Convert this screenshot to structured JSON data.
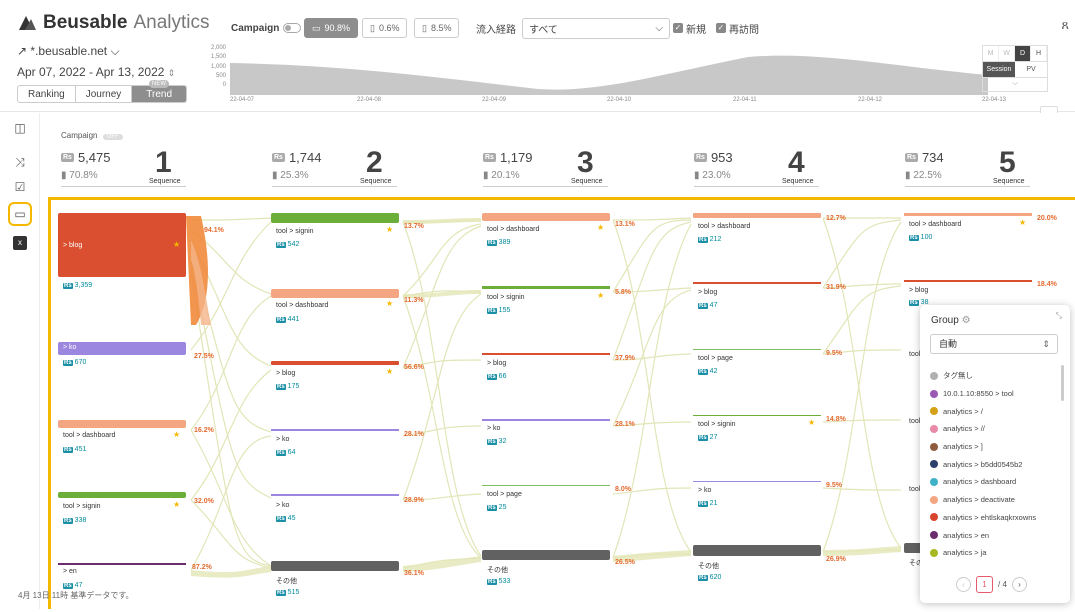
{
  "header": {
    "logo_brand": "Beusable",
    "logo_product": "Analytics",
    "site": "*.beusable.net",
    "date_range": "Apr 07, 2022 - Apr 13, 2022",
    "tabs": [
      "Ranking",
      "Journey",
      "Trend"
    ],
    "new_badge": "NEW",
    "campaign_label": "Campaign",
    "devices": [
      {
        "icon": "desktop-icon",
        "value": "90.8%",
        "active": true
      },
      {
        "icon": "tablet-icon",
        "value": "0.6%",
        "active": false
      },
      {
        "icon": "mobile-icon",
        "value": "8.5%",
        "active": false
      }
    ],
    "inflow_label": "流入経路",
    "inflow_value": "すべて",
    "check_new": "新規",
    "check_return": "再訪問"
  },
  "mini_chart": {
    "y_ticks": [
      "2,000",
      "1,500",
      "1,000",
      "500",
      "0"
    ],
    "x_ticks": [
      "22-04-07",
      "22-04-08",
      "22-04-09",
      "22-04-10",
      "22-04-11",
      "22-04-12",
      "22-04-13"
    ],
    "granularity": [
      "M",
      "W",
      "D",
      "H"
    ],
    "metric": [
      "Session",
      "PV"
    ]
  },
  "campaign_status": {
    "label": "Campaign",
    "state": "OFF"
  },
  "sequences": [
    {
      "count": "5,475",
      "pct": "70.8%",
      "num": "1",
      "label": "Sequence"
    },
    {
      "count": "1,744",
      "pct": "25.3%",
      "num": "2",
      "label": "Sequence"
    },
    {
      "count": "1,179",
      "pct": "20.1%",
      "num": "3",
      "label": "Sequence"
    },
    {
      "count": "953",
      "pct": "23.0%",
      "num": "4",
      "label": "Sequence"
    },
    {
      "count": "734",
      "pct": "22.5%",
      "num": "5",
      "label": "Sequence"
    }
  ],
  "rs_badge": "Rs",
  "nodes": [
    {
      "name": "> blog",
      "count": "3,359",
      "pct": "94.1%"
    },
    {
      "name": "> ko",
      "count": "670",
      "pct": "27.5%"
    },
    {
      "name": "tool > dashboard",
      "count": "451",
      "pct": "16.2%"
    },
    {
      "name": "tool > signin",
      "count": "338",
      "pct": "32.0%"
    },
    {
      "name": "> en",
      "count": "47",
      "pct": "87.2%"
    },
    {
      "name": "tool > signin",
      "count": "542",
      "pct": "13.7%"
    },
    {
      "name": "tool > dashboard",
      "count": "441",
      "pct": "11.3%"
    },
    {
      "name": "> blog",
      "count": "175",
      "pct": "56.6%"
    },
    {
      "name": "> ko",
      "count": "64",
      "pct": "28.1%"
    },
    {
      "name": "> ko",
      "count": "45",
      "pct": "28.9%"
    },
    {
      "name": "その他",
      "count": "515",
      "pct": "36.1%"
    },
    {
      "name": "tool > dashboard",
      "count": "389",
      "pct": "13.1%"
    },
    {
      "name": "tool > signin",
      "count": "155",
      "pct": "5.8%"
    },
    {
      "name": "> blog",
      "count": "66",
      "pct": "37.9%"
    },
    {
      "name": "> ko",
      "count": "32",
      "pct": "28.1%"
    },
    {
      "name": "tool > page",
      "count": "25",
      "pct": "8.0%"
    },
    {
      "name": "その他",
      "count": "533",
      "pct": "26.5%"
    },
    {
      "name": "tool > dashboard",
      "count": "212",
      "pct": "12.7%"
    },
    {
      "name": "> blog",
      "count": "47",
      "pct": "31.9%"
    },
    {
      "name": "tool > page",
      "count": "42",
      "pct": "9.5%"
    },
    {
      "name": "tool > signin",
      "count": "27",
      "pct": "14.8%"
    },
    {
      "name": "> ko",
      "count": "21",
      "pct": "9.5%"
    },
    {
      "name": "その他",
      "count": "620",
      "pct": "26.9%"
    },
    {
      "name": "tool > dashboard",
      "count": "100",
      "pct": "20.0%"
    },
    {
      "name": "> blog",
      "count": "38",
      "pct": "18.4%"
    },
    {
      "name": "tool",
      "count": "",
      "pct": ""
    },
    {
      "name": "tool",
      "count": "",
      "pct": ""
    },
    {
      "name": "tool",
      "count": "",
      "pct": ""
    },
    {
      "name": "その",
      "count": "",
      "pct": ""
    }
  ],
  "group_panel": {
    "title": "Group",
    "select_value": "自動",
    "items": [
      {
        "label": "タグ無し",
        "color": "#b0b0b0"
      },
      {
        "label": "10.0.1.10:8550 > tool",
        "color": "#9b59b6"
      },
      {
        "label": "analytics > /",
        "color": "#d4a017"
      },
      {
        "label": "analytics > //",
        "color": "#e88aa8"
      },
      {
        "label": "analytics > ]",
        "color": "#8e5b3f"
      },
      {
        "label": "analytics > b5dd0545b2",
        "color": "#2c3e6b"
      },
      {
        "label": "analytics > dashboard",
        "color": "#3fb1c8"
      },
      {
        "label": "analytics > deactivate",
        "color": "#f4a582"
      },
      {
        "label": "analytics > ehtlskaqkrxowns",
        "color": "#d9442e"
      },
      {
        "label": "analytics > en",
        "color": "#6b2d6b"
      },
      {
        "label": "analytics > ja",
        "color": "#a8b820"
      }
    ],
    "page_current": "1",
    "page_total": "/ 4"
  },
  "footer": "4月 13日 11時 基準データです。"
}
